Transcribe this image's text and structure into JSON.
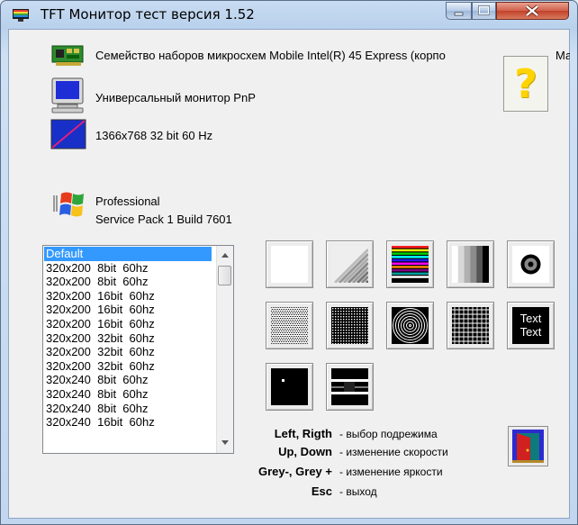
{
  "window": {
    "title": "TFT Монитор тест версия 1.52"
  },
  "info": {
    "chipset": "Семейство наборов микросхем Mobile Intel(R) 45 Express (корпо",
    "chipset_tail": "Май",
    "monitor": "Универсальный монитор PnP",
    "mode": "1366x768 32 bit 60 Hz",
    "os_edition": "Professional",
    "os_sp": "Service Pack 1 Build 7601"
  },
  "help_button": {
    "label": "?"
  },
  "video_modes": [
    "Default",
    "320x200  8bit  60hz",
    "320x200  8bit  60hz",
    "320x200  16bit  60hz",
    "320x200  16bit  60hz",
    "320x200  16bit  60hz",
    "320x200  32bit  60hz",
    "320x200  32bit  60hz",
    "320x200  32bit  60hz",
    "320x240  8bit  60hz",
    "320x240  8bit  60hz",
    "320x240  8bit  60hz",
    "320x240  16bit  60hz"
  ],
  "selected_mode": 0,
  "tests": [
    {
      "name": "white-fill-test"
    },
    {
      "name": "gradient-diagonal-test"
    },
    {
      "name": "color-bars-test"
    },
    {
      "name": "gray-bars-test"
    },
    {
      "name": "circle-target-test"
    },
    {
      "name": "checker-pattern-test"
    },
    {
      "name": "fine-dot-grid-test"
    },
    {
      "name": "concentric-circles-test"
    },
    {
      "name": "crosshatch-grid-test"
    },
    {
      "name": "text-test",
      "text": "Text\nText"
    },
    {
      "name": "dead-pixel-test"
    },
    {
      "name": "smear-bar-test"
    }
  ],
  "shortcuts": [
    {
      "key": "Left, Rigth",
      "desc": "- выбор подрежима"
    },
    {
      "key": "Up, Down",
      "desc": "- изменение скорости"
    },
    {
      "key": "Grey-, Grey +",
      "desc": "- изменение яркости"
    },
    {
      "key": "Esc",
      "desc": "- выход"
    }
  ],
  "colors": {
    "selection": "#3399ff",
    "title_bg": "#c8dcf2",
    "close_red": "#c2412a",
    "help_yellow": "#ffd400"
  }
}
